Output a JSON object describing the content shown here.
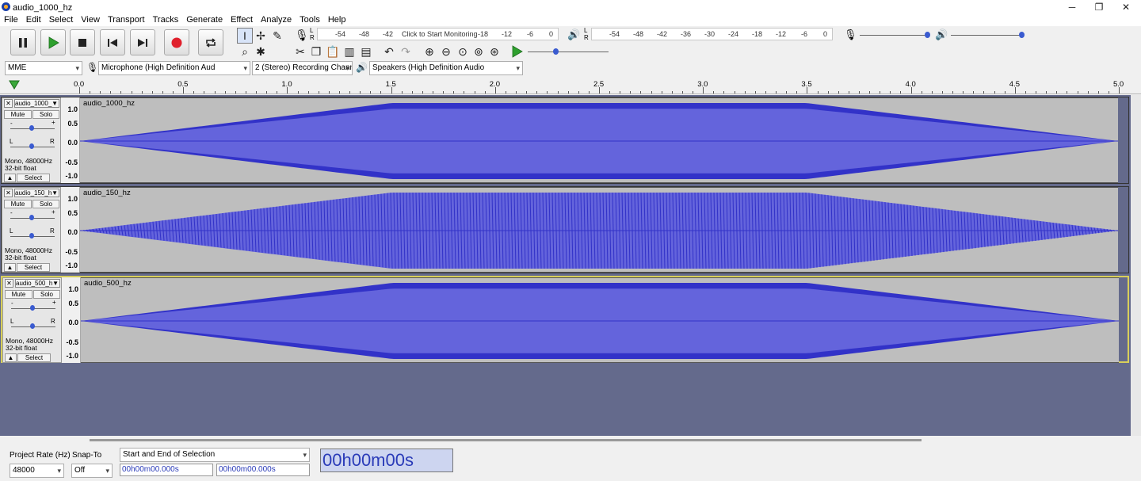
{
  "window": {
    "title": "audio_1000_hz",
    "minimize": "─",
    "maximize": "❐",
    "close": "✕"
  },
  "menu": [
    "File",
    "Edit",
    "Select",
    "View",
    "Transport",
    "Tracks",
    "Generate",
    "Effect",
    "Analyze",
    "Tools",
    "Help"
  ],
  "colors": {
    "wave_dark": "#3232c8",
    "wave_light": "#6464dc",
    "record": "#e0202c",
    "play": "#2ea02e",
    "selection": "#d8cf5a",
    "track_bg": "#646a8c"
  },
  "meters": {
    "record_ticks": [
      "-54",
      "-48",
      "-42",
      "-18",
      "-12",
      "-6",
      "0"
    ],
    "record_prompt": "Click to Start Monitoring",
    "play_ticks": [
      "-54",
      "-48",
      "-42",
      "-36",
      "-30",
      "-24",
      "-18",
      "-12",
      "-6",
      "0"
    ],
    "lr": [
      "L",
      "R"
    ]
  },
  "devices": {
    "host": "MME",
    "mic": "Microphone (High Definition Aud",
    "channels": "2 (Stereo) Recording Chann",
    "speaker": "Speakers (High Definition Audio"
  },
  "ruler": [
    "0.0",
    "0.5",
    "1.0",
    "1.5",
    "2.0",
    "2.5",
    "3.0",
    "3.5",
    "4.0",
    "4.5",
    "5.0"
  ],
  "track_common": {
    "mute": "Mute",
    "solo": "Solo",
    "minus": "-",
    "plus": "+",
    "left": "L",
    "right": "R",
    "info1": "Mono, 48000Hz",
    "info2": "32-bit float",
    "select": "Select",
    "collapse": "▲",
    "close": "✕",
    "dropdown": "▼",
    "scale": [
      "1.0",
      "0.5",
      "0.0",
      "-0.5",
      "-1.0"
    ]
  },
  "tracks": [
    {
      "short": "audio_1000_",
      "name": "audio_1000_hz",
      "kind": "dense",
      "selected": false
    },
    {
      "short": "audio_150_h",
      "name": "audio_150_hz",
      "kind": "lines",
      "selected": false
    },
    {
      "short": "audio_500_h",
      "name": "audio_500_hz",
      "kind": "dense",
      "selected": true
    }
  ],
  "bottom": {
    "rate_label": "Project Rate (Hz)",
    "rate_value": "48000",
    "snap_label": "Snap-To",
    "snap_value": "Off",
    "selection_mode": "Start and End of Selection",
    "start_time": "00h00m00.000s",
    "end_time": "00h00m00.000s",
    "position": "00h00m00s"
  }
}
